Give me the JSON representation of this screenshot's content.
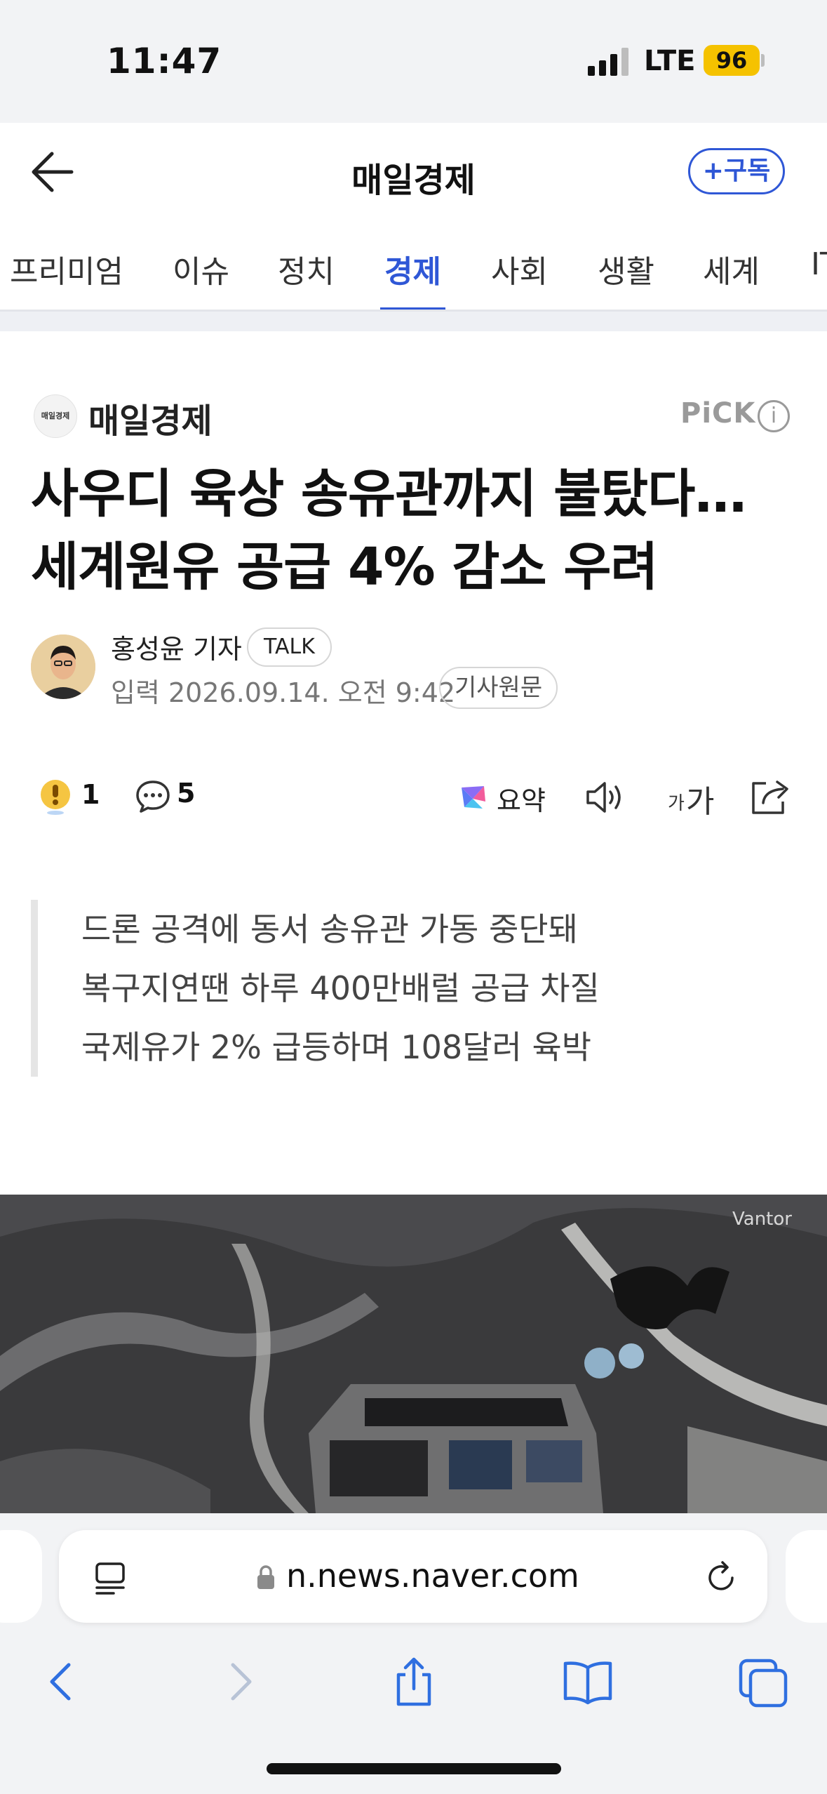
{
  "status_bar": {
    "time": "11:47",
    "network": "LTE",
    "battery": "96"
  },
  "header": {
    "title": "매일경제",
    "subscribe_label": "+구독"
  },
  "tabs": [
    {
      "label": "프리미엄"
    },
    {
      "label": "이슈"
    },
    {
      "label": "정치"
    },
    {
      "label": "경제",
      "active": true
    },
    {
      "label": "사회"
    },
    {
      "label": "생활"
    },
    {
      "label": "세계"
    },
    {
      "label": "IT"
    }
  ],
  "article": {
    "press_logo_text": "매일경제",
    "press_name": "매일경제",
    "pick_label": "PiCK",
    "headline_line1": "사우디 육상 송유관까지 불탔다…",
    "headline_line2": "세계원유 공급 4% 감소 우려",
    "reporter": "홍성윤 기자",
    "talk_label": "TALK",
    "date": "입력 2026.09.14. 오전 9:42",
    "origin_label": "기사원문",
    "reaction_count": "1",
    "comment_count": "5",
    "summary_label": "요약",
    "font_small": "가",
    "font_big": "가",
    "summary_lines": [
      "드론 공격에 동서 송유관 가동 중단돼",
      "복구지연땐 하루 400만배럴 공급 차질",
      "국제유가 2% 급등하며 108달러 육박"
    ],
    "photo_credit": "Vantor"
  },
  "safari": {
    "url": "n.news.naver.com"
  }
}
